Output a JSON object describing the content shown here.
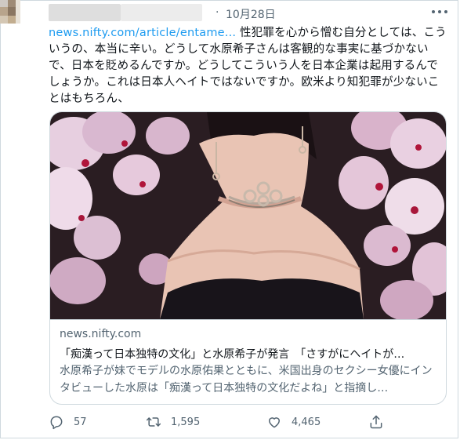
{
  "tweet": {
    "timestamp": "10月28日",
    "separator": "·",
    "link_text": "news.nifty.com/article/entame...",
    "text_after_link": " 性犯罪を心から憎む自分としては、こういうの、本当に辛い。どうして水原希子さんは客観的な事実に基づかないで、日本を貶めるんですか。どうしてこういう人を日本企業は起用するんでしょうか。これは日本人ヘイトではないですか。欧米より知犯罪が少ないことはもちろん、"
  },
  "card": {
    "domain": "news.nifty.com",
    "title": "「痴漢って日本独特の文化」と水原希子が発言　「さすがにヘイトが…",
    "description": "水原希子が妹でモデルの水原佑果とともに、米国出身のセクシー女優にインタビューした水原は「痴漢って日本独特の文化だよね」と指摘し…",
    "image_icon": "photo-woman-choker-cherry-blossoms"
  },
  "actions": {
    "reply": {
      "icon": "reply-icon",
      "count": "57"
    },
    "retweet": {
      "icon": "retweet-icon",
      "count": "1,595"
    },
    "like": {
      "icon": "heart-icon",
      "count": "4,465"
    },
    "share": {
      "icon": "share-icon"
    }
  },
  "colors": {
    "link": "#1d9bf0",
    "secondary": "#536471",
    "border": "#cfd9de",
    "text": "#0f1419"
  }
}
